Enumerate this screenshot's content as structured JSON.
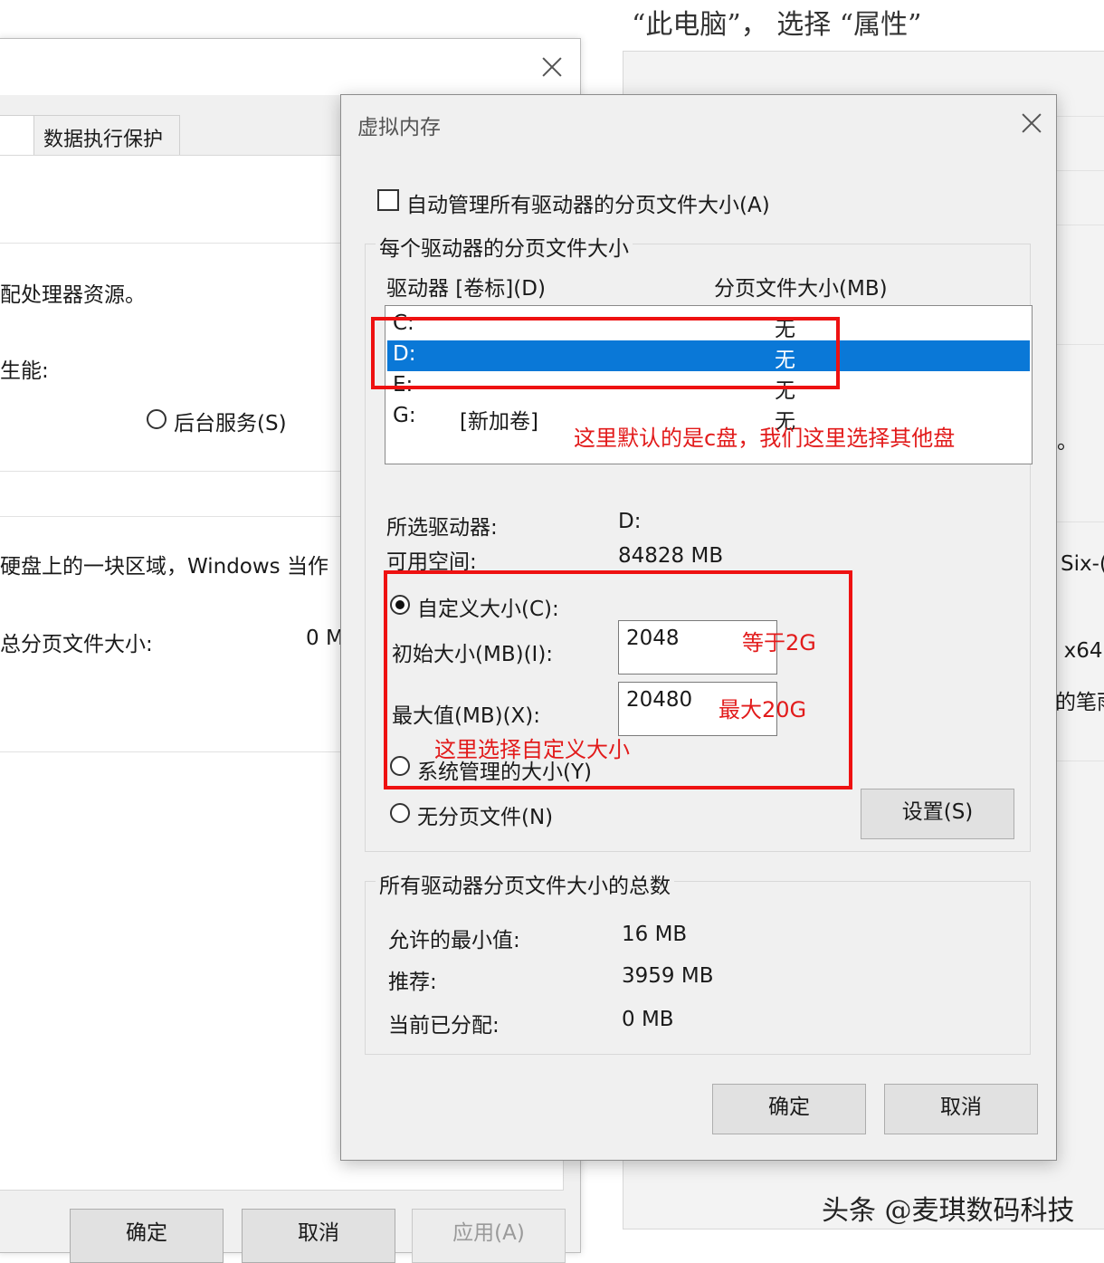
{
  "right_panel": {
    "heading": "“此电脑”， 选择 “属性”",
    "fragments": {
      "period": "。",
      "six": "Six-(",
      "x64": "- x64",
      "pen": "的笔雨"
    }
  },
  "back_dialog": {
    "tab_dep": "数据执行保护",
    "processor_text": "配处理器资源。",
    "performance_label": "生能:",
    "background_services": "后台服务(S)",
    "disk_text": "硬盘上的一块区域，Windows 当作",
    "total_paging_label": "总分页文件大小:",
    "total_paging_value": "0 M",
    "buttons": {
      "ok": "确定",
      "cancel": "取消",
      "apply": "应用(A)"
    }
  },
  "vm_dialog": {
    "title": "虚拟内存",
    "auto_manage_label": "自动管理所有驱动器的分页文件大小(A)",
    "auto_manage_checked": false,
    "per_drive_group_title": "每个驱动器的分页文件大小",
    "col_drive": "驱动器 [卷标](D)",
    "col_size": "分页文件大小(MB)",
    "drives": [
      {
        "letter": "C:",
        "label": "",
        "size": "无",
        "selected": false
      },
      {
        "letter": "D:",
        "label": "",
        "size": "无",
        "selected": true
      },
      {
        "letter": "E:",
        "label": "",
        "size": "无",
        "selected": false
      },
      {
        "letter": "G:",
        "label": "[新加卷]",
        "size": "无",
        "selected": false
      }
    ],
    "selected_drive_label": "所选驱动器:",
    "selected_drive_value": "D:",
    "free_space_label": "可用空间:",
    "free_space_value": "84828 MB",
    "custom_size_label": "自定义大小(C):",
    "initial_size_label": "初始大小(MB)(I):",
    "initial_size_value": "2048",
    "max_size_label": "最大值(MB)(X):",
    "max_size_value": "20480",
    "system_managed_label": "系统管理的大小(Y)",
    "no_paging_label": "无分页文件(N)",
    "set_button": "设置(S)",
    "total_group_title": "所有驱动器分页文件大小的总数",
    "min_allowed_label": "允许的最小值:",
    "min_allowed_value": "16 MB",
    "recommended_label": "推荐:",
    "recommended_value": "3959 MB",
    "allocated_label": "当前已分配:",
    "allocated_value": "0 MB",
    "ok_button": "确定",
    "cancel_button": "取消"
  },
  "annotations": {
    "drive_note": "这里默认的是c盘，我们这里选择其他盘",
    "initial_note": "等于2G",
    "max_note": "最大20G",
    "custom_note": "这里选择自定义大小",
    "color": "#e11111"
  },
  "watermark": "头条 @麦琪数码科技"
}
